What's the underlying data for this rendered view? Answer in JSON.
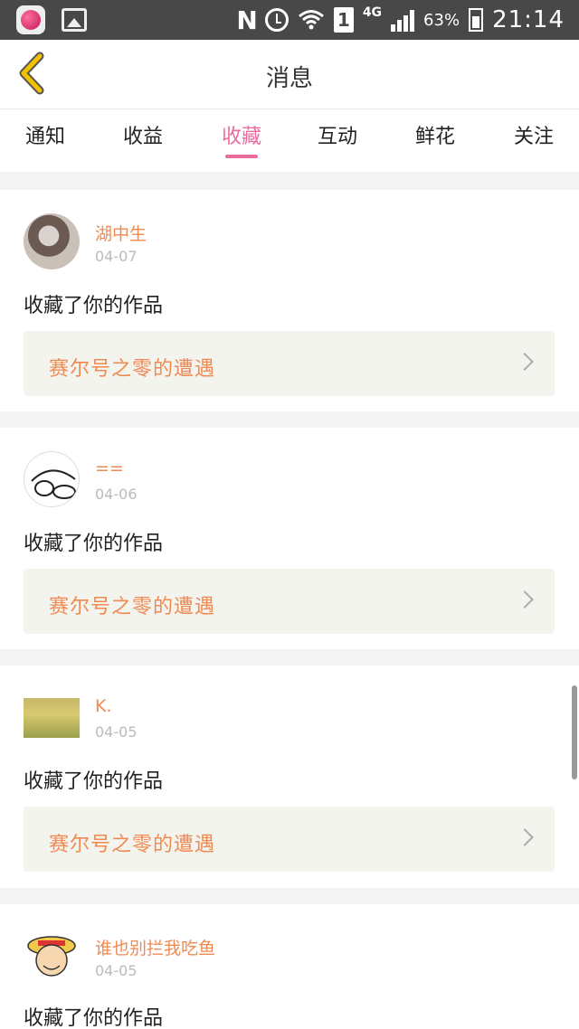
{
  "status_bar": {
    "network": "4G",
    "sim": "1",
    "battery": "63%",
    "time": "21:14"
  },
  "header": {
    "title": "消息"
  },
  "tabs": [
    {
      "label": "通知"
    },
    {
      "label": "收益"
    },
    {
      "label": "收藏"
    },
    {
      "label": "互动"
    },
    {
      "label": "鲜花"
    },
    {
      "label": "关注"
    }
  ],
  "active_tab": "收藏",
  "items": [
    {
      "user": "湖中生",
      "date": "04-07",
      "action": "收藏了你的作品",
      "work": "赛尔号之零的遭遇"
    },
    {
      "user": "==",
      "date": "04-06",
      "action": "收藏了你的作品",
      "work": "赛尔号之零的遭遇"
    },
    {
      "user": "K.",
      "date": "04-05",
      "action": "收藏了你的作品",
      "work": "赛尔号之零的遭遇"
    },
    {
      "user": "谁也别拦我吃鱼",
      "date": "04-05",
      "action": "收藏了你的作品"
    }
  ],
  "colors": {
    "accent_pink": "#e86d9e",
    "name_orange": "#f08a53",
    "back_yellow": "#f2c200"
  }
}
